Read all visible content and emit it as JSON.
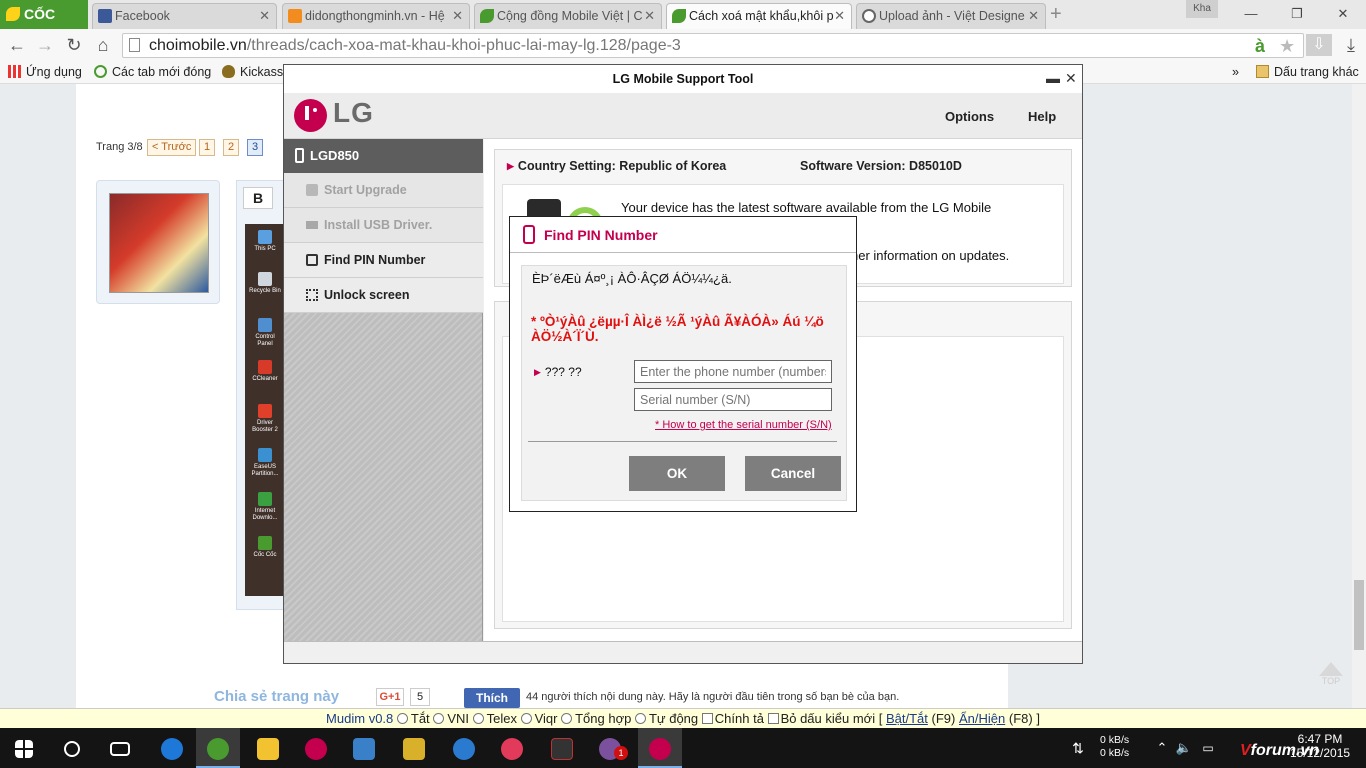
{
  "browser": {
    "brand": "CỐC CỐC",
    "tabs": [
      {
        "label": "Facebook",
        "icon": "facebook-icon",
        "color": "#3b5998"
      },
      {
        "label": "didongthongminh.vn - Hệ",
        "icon": "site-icon",
        "color": "#f28c1e"
      },
      {
        "label": "Cộng đồng Mobile Việt | C",
        "icon": "leaf-icon",
        "color": "#4a9b2f"
      },
      {
        "label": "Cách xoá mật khẩu,khôi p",
        "icon": "leaf-icon",
        "color": "#4a9b2f"
      },
      {
        "label": "Upload ảnh - Việt Designe",
        "icon": "globe-icon",
        "color": "#666666"
      }
    ],
    "user": "Kha",
    "url_host": "choimobile.vn",
    "url_path": "/threads/cach-xoa-mat-khau-khoi-phuc-lai-may-lg.128/page-3",
    "bookmarks": [
      "Ứng dụng",
      "Các tab mới đóng",
      "Kickass"
    ],
    "bookmarks_more": "»",
    "bookmark_folder": "Dấu trang khác"
  },
  "page": {
    "pager_label": "Trang 3/8",
    "pager": [
      "< Trước",
      "1",
      "2",
      "3"
    ],
    "pager_current": "3",
    "editor_bold": "B",
    "desktop_icons": [
      "This PC",
      "Recycle Bin",
      "Control Panel",
      "CCleaner",
      "Driver Booster 2",
      "EaseUS Partition...",
      "Internet Downlo...",
      "Cốc Cốc"
    ],
    "share_label": "Chia sẻ trang này",
    "gplus": "G+1",
    "gplus_count": "5",
    "fb_like": "Thích",
    "fb_text": "44 người thích nội dung này. Hãy là người đầu tiên trong số bạn bè của bạn.",
    "top_label": "TOP"
  },
  "mudim": {
    "name": "Mudim",
    "version": "v0.8",
    "modes": [
      "Tắt",
      "VNI",
      "Telex",
      "Viqr",
      "Tổng hợp",
      "Tự động"
    ],
    "options": [
      "Chính tả",
      "Bỏ dấu kiểu mới"
    ],
    "toggle": "Bật/Tắt",
    "toggle_key": "(F9)",
    "showhide": "Ẩn/Hiện",
    "showhide_key": "(F8)"
  },
  "lg": {
    "title": "LG Mobile Support Tool",
    "brand": "LG",
    "menu": [
      "Options",
      "Help"
    ],
    "model": "LGD850",
    "sidebar": [
      {
        "label": "Start Upgrade",
        "icon": "upgrade-icon",
        "enabled": false
      },
      {
        "label": "Install USB Driver.",
        "icon": "usb-icon",
        "enabled": false
      },
      {
        "label": "Find PIN Number",
        "icon": "lock-icon",
        "enabled": true
      },
      {
        "label": "Unlock screen",
        "icon": "unlock-icon",
        "enabled": true
      }
    ],
    "country": "Country Setting: Republic of Korea",
    "software": "Software Version: D85010D",
    "msg1": "Your device has the latest software available from the LG Mobile",
    "msg2": "her information on updates.",
    "accent": "#c4004e"
  },
  "pin_dialog": {
    "title": "Find PIN Number",
    "info": "ÈÞ´ëÆù Á¤º¸¡ ÀÔ·ÂÇØ ÁÖ¼¼¿ä.",
    "warning": "* ºÒ¹ýÀû ¿ëµµ·Î ÀÌ¿ë ½Ã ¹ýÀû Ã¥ÀÓÀ» Áú ¼ö ÀÖ½À´Ï´Ù.",
    "field_label": "??? ??",
    "phone_placeholder": "Enter the phone number (numbers",
    "serial_placeholder": "Serial number (S/N)",
    "help_link": "* How to get the serial number (S/N)",
    "ok": "OK",
    "cancel": "Cancel"
  },
  "taskbar": {
    "net_up": "0 kB/s",
    "net_down": "0 kB/s",
    "time": "6:47 PM",
    "date": "15/12/2015",
    "viber_badge": "1",
    "watermark_v": "V",
    "watermark_rest": "forum.vn"
  }
}
